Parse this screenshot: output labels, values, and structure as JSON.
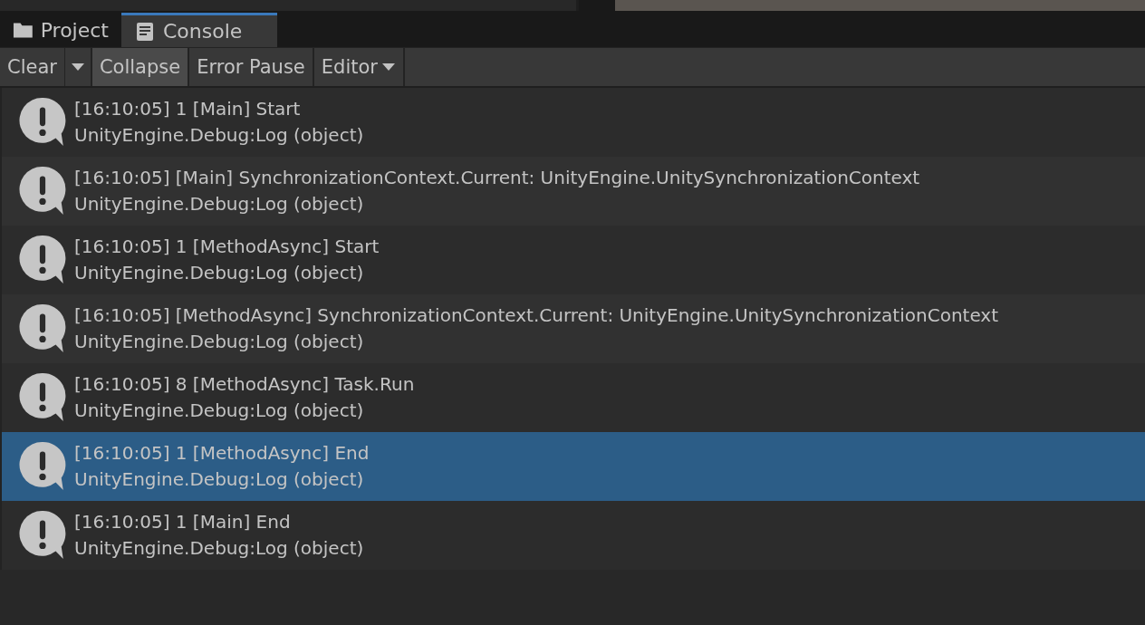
{
  "tabs": [
    {
      "label": "Project",
      "kind": "folder",
      "selected": false
    },
    {
      "label": "Console",
      "kind": "console",
      "selected": true
    }
  ],
  "toolbar": [
    {
      "kind": "button",
      "label": "Clear"
    },
    {
      "kind": "caret"
    },
    {
      "kind": "toggle",
      "label": "Collapse",
      "on": true
    },
    {
      "kind": "toggle",
      "label": "Error Pause",
      "on": false
    },
    {
      "kind": "dropdown",
      "label": "Editor"
    }
  ],
  "entries": [
    {
      "message": "[16:10:05] 1 [Main] Start",
      "trace": "UnityEngine.Debug:Log (object)",
      "selected": false
    },
    {
      "message": "[16:10:05] [Main] SynchronizationContext.Current: UnityEngine.UnitySynchronizationContext",
      "trace": "UnityEngine.Debug:Log (object)",
      "selected": false
    },
    {
      "message": "[16:10:05] 1 [MethodAsync] Start",
      "trace": "UnityEngine.Debug:Log (object)",
      "selected": false
    },
    {
      "message": "[16:10:05] [MethodAsync] SynchronizationContext.Current: UnityEngine.UnitySynchronizationContext",
      "trace": "UnityEngine.Debug:Log (object)",
      "selected": false
    },
    {
      "message": "[16:10:05] 8 [MethodAsync] Task.Run",
      "trace": "UnityEngine.Debug:Log (object)",
      "selected": false
    },
    {
      "message": "[16:10:05] 1 [MethodAsync] End",
      "trace": "UnityEngine.Debug:Log (object)",
      "selected": true
    },
    {
      "message": "[16:10:05] 1 [Main] End",
      "trace": "UnityEngine.Debug:Log (object)",
      "selected": false
    }
  ]
}
